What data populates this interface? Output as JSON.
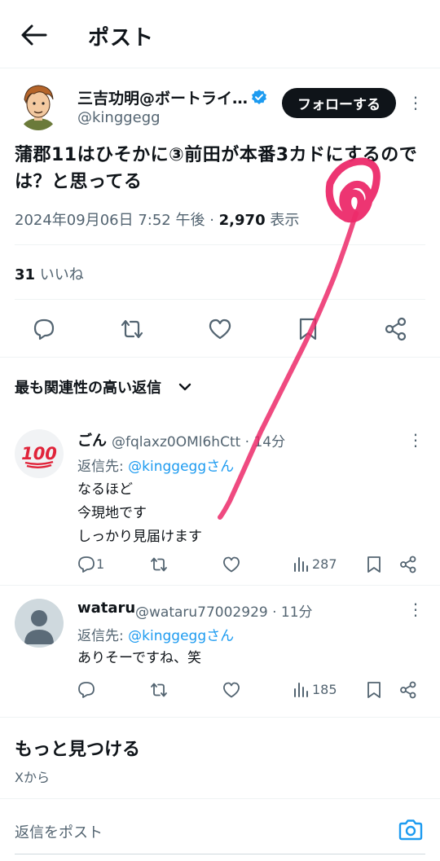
{
  "header": {
    "title": "ポスト"
  },
  "post": {
    "author_name": "三吉功明@ボートライ…",
    "author_handle": "@kinggegg",
    "follow_label": "フォローする",
    "text": "蒲郡11はひそかに③前田が本番3カドにするのでは？と思ってる",
    "timestamp": "2024年09月06日 7:52 午後",
    "separator": " · ",
    "views_count": "2,970",
    "views_label": " 表示",
    "likes_count": "31",
    "likes_label": " いいね"
  },
  "replies_sort": {
    "label": "最も関連性の高い返信"
  },
  "replies": [
    {
      "name": "ごん",
      "handle": "@fqlaxz0OMl6hCtt · 14分",
      "reply_to_prefix": "返信先: ",
      "reply_to_handle": "@kinggeggさん",
      "body": "なるほど\n今現地です\nしっかり見届けます",
      "reply_count": "1",
      "views": "287",
      "avatar_icon": "hundred-points-emoji"
    },
    {
      "name": "wataru",
      "handle": "@wataru77002929 · 11分",
      "reply_to_prefix": "返信先: ",
      "reply_to_handle": "@kinggeggさん",
      "body": "ありそーですね、笑",
      "reply_count": "",
      "views": "185",
      "avatar_icon": "default-person-avatar"
    }
  ],
  "discover": {
    "title": "もっと見つける",
    "subtitle": "Xから"
  },
  "reply_bar": {
    "placeholder": "返信をポスト"
  },
  "colors": {
    "accent": "#1d9bf0",
    "text": "#0f1419",
    "muted": "#536471",
    "scribble": "#ec2a6a"
  }
}
